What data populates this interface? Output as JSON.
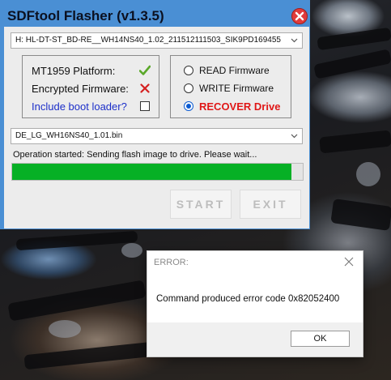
{
  "app": {
    "title": "SDFtool Flasher (v1.3.5)",
    "drive_selector": "H:  HL-DT-ST_BD-RE__WH14NS40_1.02_211512111503_SIK9PD169455",
    "info": {
      "platform_label": "MT1959 Platform:",
      "platform_ok": true,
      "encrypted_label": "Encrypted Firmware:",
      "encrypted_ok": false,
      "bootloader_label": "Include boot loader?",
      "bootloader_checked": false
    },
    "modes": {
      "read_label": "READ Firmware",
      "write_label": "WRITE Firmware",
      "recover_label": "RECOVER Drive",
      "selected": "recover"
    },
    "firmware_file": "DE_LG_WH16NS40_1.01.bin",
    "status": "Operation started: Sending flash image to drive. Please wait...",
    "progress_percent": 96,
    "start_label": "START",
    "exit_label": "EXIT",
    "colors": {
      "window_accent": "#4a8fd4",
      "progress_fill": "#06b025",
      "close_button": "#e03b3b",
      "ok_check": "#5aa82a",
      "fail_cross": "#d42020",
      "recover_text": "#e01818"
    }
  },
  "error_dialog": {
    "title": "ERROR:",
    "message": "Command produced error code 0x82052400",
    "ok_label": "OK"
  },
  "icons": {
    "close": "close-icon",
    "check": "checkmark-icon",
    "cross": "cross-icon",
    "chevron": "chevron-down-icon"
  }
}
